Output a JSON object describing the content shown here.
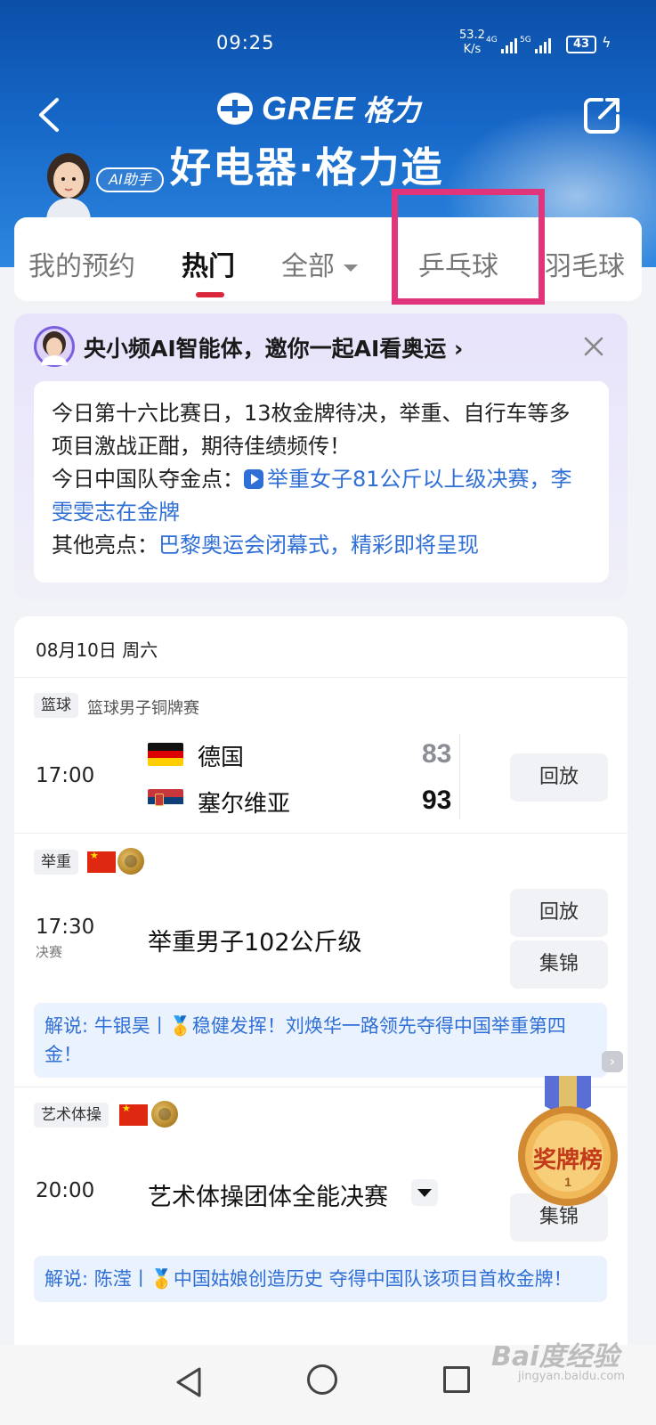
{
  "status_bar": {
    "time": "09:25",
    "net_speed_value": "53.2",
    "net_speed_unit": "K/s",
    "network1": "4G",
    "network2": "5G",
    "battery": "43"
  },
  "header": {
    "brand": "GREE",
    "brand_cn": "格力",
    "slogan": "好电器·格力造",
    "ai_badge": "AI助手"
  },
  "tabs": [
    {
      "label": "我的预约"
    },
    {
      "label": "热门"
    },
    {
      "label": "全部"
    },
    {
      "label": "乒乓球"
    },
    {
      "label": "羽毛球"
    }
  ],
  "ai_card": {
    "title": "央小频AI智能体，邀你一起AI看奥运 ›",
    "line1": "今日第十六比赛日，13枚金牌待决，举重、自行车等多项目激战正酣，期待佳绩频传！",
    "gold_label": "今日中国队夺金点：",
    "gold_link": "举重女子81公斤以上级决赛，李雯雯志在金牌",
    "other_label": "其他亮点：",
    "other_link": "巴黎奥运会闭幕式，精彩即将呈现"
  },
  "schedule": {
    "date": "08月10日 周六",
    "events": [
      {
        "tag": "篮球",
        "subtitle": "篮球男子铜牌赛",
        "time": "17:00",
        "team1": "德国",
        "score1": "83",
        "team2": "塞尔维亚",
        "score2": "93",
        "button": "回放"
      },
      {
        "tag": "举重",
        "time": "17:30",
        "stage": "决赛",
        "name": "举重男子102公斤级",
        "buttons": [
          "回放",
          "集锦"
        ],
        "commentary": "解说: 牛银昊丨🥇稳健发挥！刘焕华一路领先夺得中国举重第四金！"
      },
      {
        "tag": "艺术体操",
        "time": "20:00",
        "name": "艺术体操团体全能决赛",
        "buttons": [
          "集锦"
        ],
        "commentary": "解说: 陈滢丨🥇中国姑娘创造历史 夺得中国队该项目首枚金牌！"
      }
    ]
  },
  "medal_widget": {
    "label": "奖牌榜",
    "rank": "1"
  },
  "watermark": {
    "main": "Bai度经验",
    "sub": "jingyan.baidu.com"
  },
  "colors": {
    "header_blue": "#1667c7",
    "accent_red": "#d9263a",
    "link_blue": "#2f6fd6",
    "highlight_pink": "#e0357a"
  }
}
